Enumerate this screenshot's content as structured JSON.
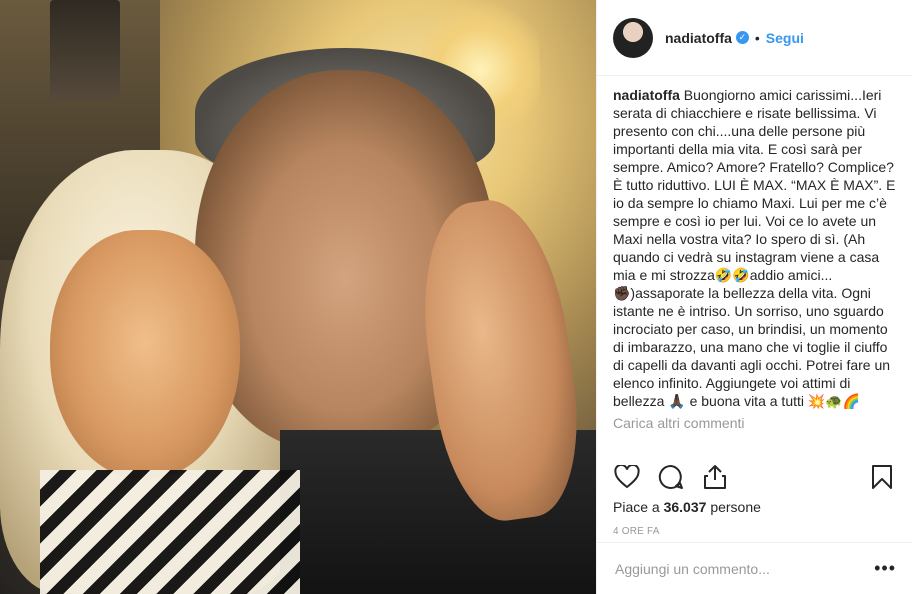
{
  "post": {
    "username": "nadiatoffa",
    "verified": true,
    "follow_label": "Segui",
    "separator": "•",
    "caption": "Buongiorno amici carissimi...Ieri serata di chiacchiere e risate bellissima. Vi presento con chi....una delle persone più importanti della mia vita. E così sarà per sempre. Amico? Amore? Fratello? Complice? È tutto riduttivo. LUI È MAX. “MAX È MAX”. E io da sempre lo chiamo Maxi. Lui per me c’è sempre e così io per lui. Voi ce lo avete un Maxi nella vostra vita? Io spero di sì. (Ah quando ci vedrà su instagram viene a casa mia e mi strozza🤣🤣addio amici...✊🏿)assaporate la bellezza della vita. Ogni istante ne è intriso. Un sorriso, uno sguardo incrociato per caso, un brindisi, un momento di imbarazzo, una mano che vi toglie il ciuffo di capelli da davanti agli occhi. Potrei fare un elenco infinito. Aggiungete voi attimi di bellezza 🙏🏿 e buona vita a tutti 💥🐢🌈",
    "load_more": "Carica altri commenti",
    "likes_prefix": "Piace a",
    "likes_count": "36.037",
    "likes_suffix": "persone",
    "time_ago": "4 ORE FA",
    "comment_placeholder": "Aggiungi un commento...",
    "more_label": "•••"
  },
  "icons": {
    "like": "heart-icon",
    "comment": "comment-icon",
    "share": "share-icon",
    "save": "bookmark-icon",
    "verified": "verified-badge-icon"
  },
  "colors": {
    "accent": "#3897f0",
    "text": "#262626",
    "muted": "#999999",
    "border": "#efefef"
  }
}
